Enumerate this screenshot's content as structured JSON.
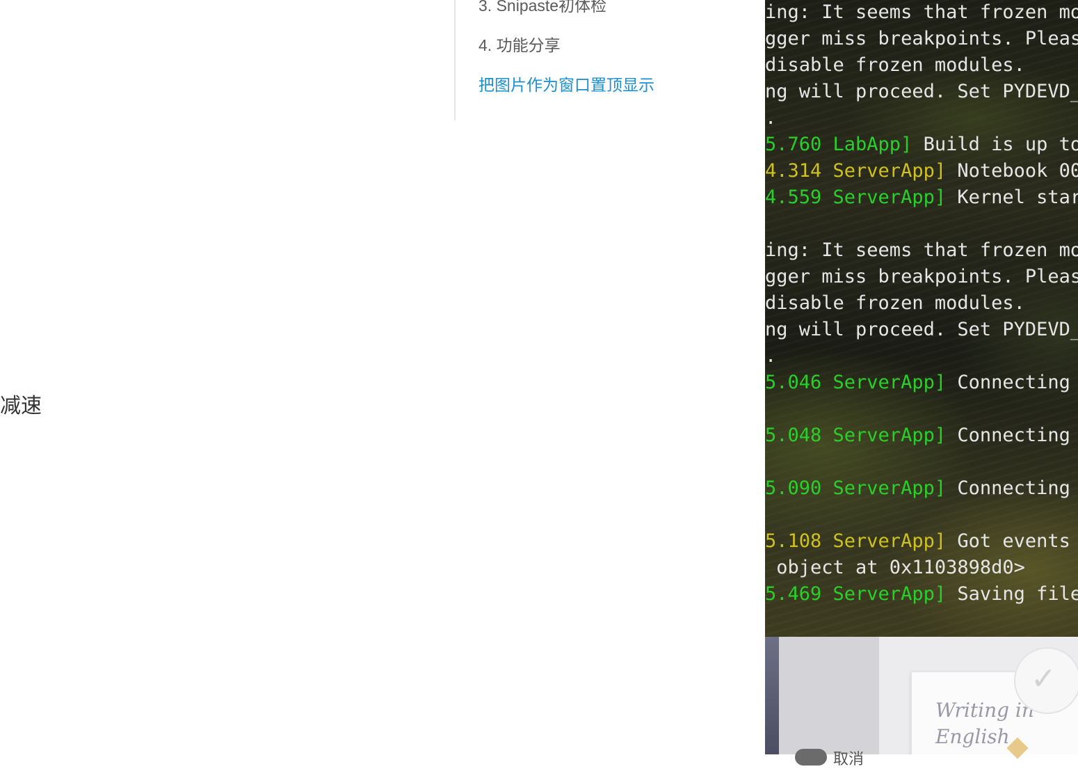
{
  "blog": {
    "toc": [
      {
        "label": "3. Snipaste初体检"
      },
      {
        "label": "4. 功能分享"
      },
      {
        "label": "把图片作为窗口置顶显示"
      }
    ],
    "body_fragment": "减速"
  },
  "terminal": {
    "colors": {
      "timestamp_green": "#2ad02a",
      "timestamp_yellow": "#cfc21e",
      "text": "#e6e6e6"
    },
    "lines": [
      [
        {
          "t": "ing: It seems that frozen mo",
          "c": "white"
        }
      ],
      [
        {
          "t": "gger miss breakpoints. Pleas",
          "c": "white"
        }
      ],
      [
        {
          "t": "disable frozen modules.",
          "c": "white"
        }
      ],
      [
        {
          "t": "ng will proceed. Set PYDEVD_",
          "c": "white"
        }
      ],
      [
        {
          "t": ".",
          "c": "white"
        }
      ],
      [
        {
          "t": "5.760 LabApp]",
          "c": "green"
        },
        {
          "t": " Build is up to",
          "c": "white"
        }
      ],
      [
        {
          "t": "4.314 ServerApp]",
          "c": "yellow"
        },
        {
          "t": " Notebook 00",
          "c": "white"
        }
      ],
      [
        {
          "t": "4.559 ServerApp]",
          "c": "green"
        },
        {
          "t": " Kernel star",
          "c": "white"
        }
      ],
      [],
      [
        {
          "t": "ing: It seems that frozen mo",
          "c": "white"
        }
      ],
      [
        {
          "t": "gger miss breakpoints. Pleas",
          "c": "white"
        }
      ],
      [
        {
          "t": "disable frozen modules.",
          "c": "white"
        }
      ],
      [
        {
          "t": "ng will proceed. Set PYDEVD_",
          "c": "white"
        }
      ],
      [
        {
          "t": ".",
          "c": "white"
        }
      ],
      [
        {
          "t": "5.046 ServerApp]",
          "c": "green"
        },
        {
          "t": " Connecting",
          "c": "white"
        }
      ],
      [],
      [
        {
          "t": "5.048 ServerApp]",
          "c": "green"
        },
        {
          "t": " Connecting",
          "c": "white"
        }
      ],
      [],
      [
        {
          "t": "5.090 ServerApp]",
          "c": "green"
        },
        {
          "t": " Connecting",
          "c": "white"
        }
      ],
      [],
      [
        {
          "t": "5.108 ServerApp]",
          "c": "yellow"
        },
        {
          "t": " Got events",
          "c": "white"
        }
      ],
      [
        {
          "t": " object at 0x1103898d0>",
          "c": "white"
        }
      ],
      [
        {
          "t": "5.469 ServerApp]",
          "c": "green"
        },
        {
          "t": " Saving file",
          "c": "white"
        }
      ]
    ]
  },
  "desktop": {
    "card_text": "Writing in English",
    "toggle_label": "取消",
    "seal_icon": "check-icon"
  }
}
